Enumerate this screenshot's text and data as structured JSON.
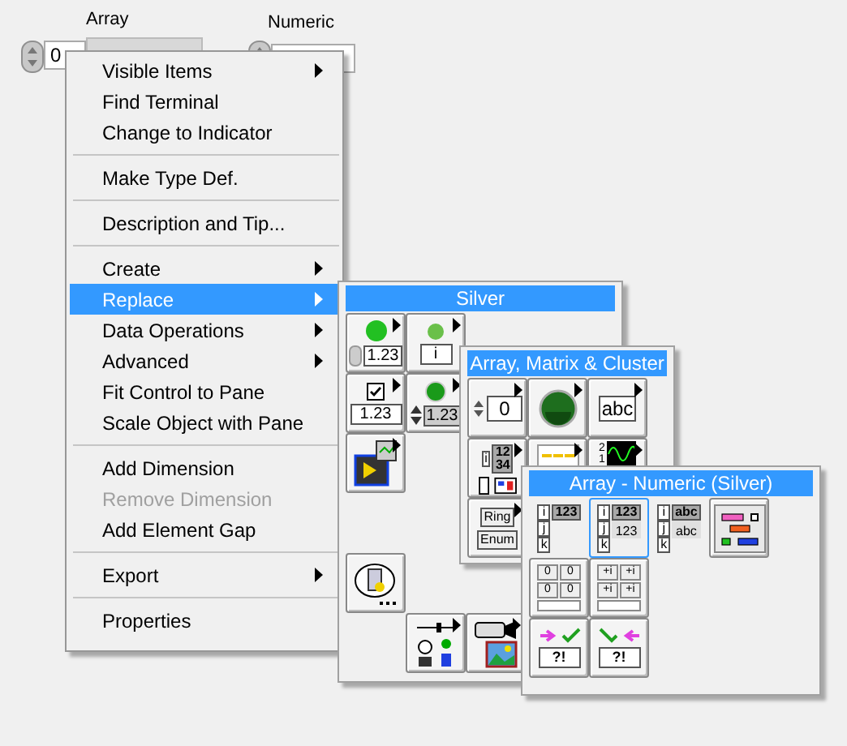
{
  "front_panel": {
    "controls": [
      {
        "label": "Array",
        "value": "0"
      },
      {
        "label": "Numeric"
      }
    ]
  },
  "context_menu": {
    "groups": [
      [
        {
          "label": "Visible Items",
          "submenu": true,
          "selected": false,
          "disabled": false
        },
        {
          "label": "Find Terminal",
          "submenu": false,
          "selected": false,
          "disabled": false
        },
        {
          "label": "Change to Indicator",
          "submenu": false,
          "selected": false,
          "disabled": false
        }
      ],
      [
        {
          "label": "Make Type Def.",
          "submenu": false,
          "selected": false,
          "disabled": false
        }
      ],
      [
        {
          "label": "Description and Tip...",
          "submenu": false,
          "selected": false,
          "disabled": false
        }
      ],
      [
        {
          "label": "Create",
          "submenu": true,
          "selected": false,
          "disabled": false
        },
        {
          "label": "Replace",
          "submenu": true,
          "selected": true,
          "disabled": false
        },
        {
          "label": "Data Operations",
          "submenu": true,
          "selected": false,
          "disabled": false
        },
        {
          "label": "Advanced",
          "submenu": true,
          "selected": false,
          "disabled": false
        },
        {
          "label": "Fit Control to Pane",
          "submenu": false,
          "selected": false,
          "disabled": false
        },
        {
          "label": "Scale Object with Pane",
          "submenu": false,
          "selected": false,
          "disabled": false
        }
      ],
      [
        {
          "label": "Add Dimension",
          "submenu": false,
          "selected": false,
          "disabled": false
        },
        {
          "label": "Remove Dimension",
          "submenu": false,
          "selected": false,
          "disabled": true
        },
        {
          "label": "Add Element Gap",
          "submenu": false,
          "selected": false,
          "disabled": false
        }
      ],
      [
        {
          "label": "Export",
          "submenu": true,
          "selected": false,
          "disabled": false
        }
      ],
      [
        {
          "label": "Properties",
          "submenu": false,
          "selected": false,
          "disabled": false
        }
      ]
    ]
  },
  "palettes": [
    {
      "title": "Silver",
      "items": [
        {
          "kind": "led-numeric",
          "texts": [
            "1.23"
          ],
          "submenu": true,
          "selected": false
        },
        {
          "kind": "led-field",
          "texts": [
            "i"
          ],
          "submenu": true,
          "selected": false
        },
        {
          "kind": "checkbox-numeric",
          "texts": [
            "1.23"
          ],
          "submenu": true,
          "selected": false
        },
        {
          "kind": "led-spin",
          "texts": [
            "1.23"
          ],
          "submenu": true,
          "selected": false
        },
        {
          "kind": "graph",
          "submenu": true,
          "selected": false
        },
        {
          "kind": "tip",
          "submenu": false,
          "selected": false
        },
        {
          "kind": "io",
          "submenu": true,
          "selected": false
        },
        {
          "kind": "picture",
          "submenu": true,
          "selected": false
        }
      ]
    },
    {
      "title": "Array, Matrix & Cluster",
      "items": [
        {
          "kind": "numeric",
          "texts": [
            "0"
          ],
          "submenu": true,
          "selected": false
        },
        {
          "kind": "boolean",
          "submenu": true,
          "selected": false
        },
        {
          "kind": "string",
          "texts": [
            "abc"
          ],
          "submenu": true,
          "selected": false
        },
        {
          "kind": "array",
          "texts": [
            "i",
            "12",
            "34"
          ],
          "submenu": true,
          "selected": false
        },
        {
          "kind": "list",
          "submenu": true,
          "selected": false
        },
        {
          "kind": "chart",
          "texts": [
            "2",
            "1"
          ],
          "submenu": true,
          "selected": false
        },
        {
          "kind": "ring",
          "texts": [
            "Ring",
            "Enum"
          ],
          "submenu": true,
          "selected": false
        }
      ]
    },
    {
      "title": "Array - Numeric (Silver)",
      "items": [
        {
          "kind": "index-array",
          "texts": [
            "i",
            "j",
            "k",
            "123"
          ],
          "submenu": false,
          "selected": false
        },
        {
          "kind": "index-array",
          "texts": [
            "i",
            "j",
            "k",
            "123",
            "123"
          ],
          "submenu": false,
          "selected": true
        },
        {
          "kind": "index-array",
          "texts": [
            "i",
            "j",
            "k",
            "abc",
            "abc"
          ],
          "submenu": false,
          "selected": false
        },
        {
          "kind": "cluster",
          "submenu": false,
          "selected": false
        },
        {
          "kind": "matrix",
          "texts": [
            "0",
            "0",
            "0",
            "0"
          ],
          "submenu": false,
          "selected": false
        },
        {
          "kind": "matrix",
          "texts": [
            "+i",
            "+i",
            "+i",
            "+i"
          ],
          "submenu": false,
          "selected": false
        },
        {
          "kind": "compare",
          "texts": [
            "?!"
          ],
          "submenu": false,
          "selected": false,
          "flip": false
        },
        {
          "kind": "compare",
          "texts": [
            "?!"
          ],
          "submenu": false,
          "selected": false,
          "flip": true
        }
      ]
    }
  ]
}
